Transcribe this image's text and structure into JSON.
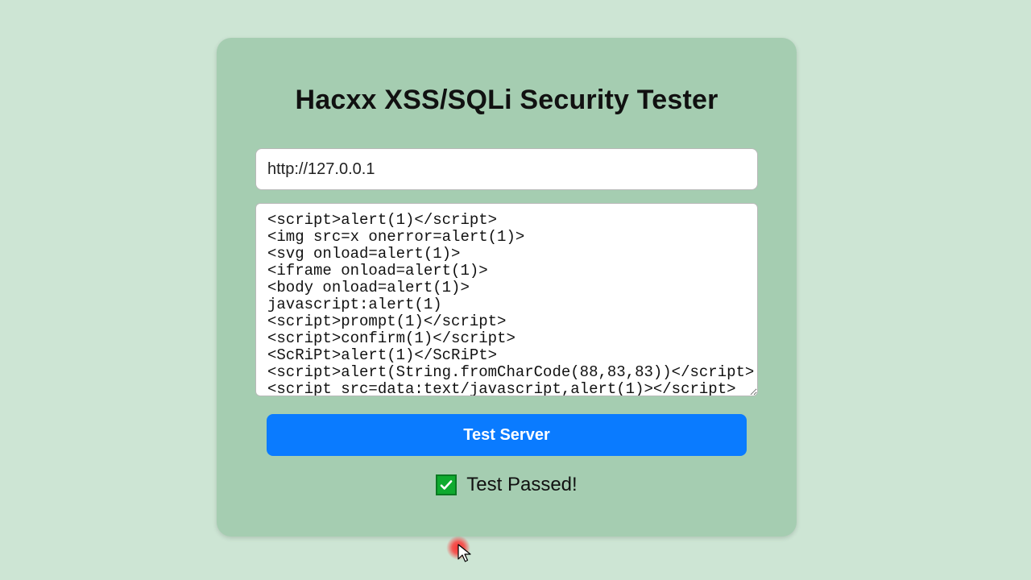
{
  "app": {
    "title": "Hacxx XSS/SQLi Security Tester"
  },
  "form": {
    "url_value": "http://127.0.0.1",
    "payloads_value": "<script>alert(1)</script>\n<img src=x onerror=alert(1)>\n<svg onload=alert(1)>\n<iframe onload=alert(1)>\n<body onload=alert(1)>\njavascript:alert(1)\n<script>prompt(1)</script>\n<script>confirm(1)</script>\n<ScRiPt>alert(1)</ScRiPt>\n<script>alert(String.fromCharCode(88,83,83))</script>\n<script src=data:text/javascript,alert(1)></script>",
    "test_button_label": "Test Server"
  },
  "result": {
    "status_text": "Test Passed!",
    "passed": true
  },
  "colors": {
    "page_bg": "#cde5d4",
    "card_bg": "#a5cdb1",
    "button_bg": "#0a7bff",
    "success_bg": "#0faa2f"
  }
}
